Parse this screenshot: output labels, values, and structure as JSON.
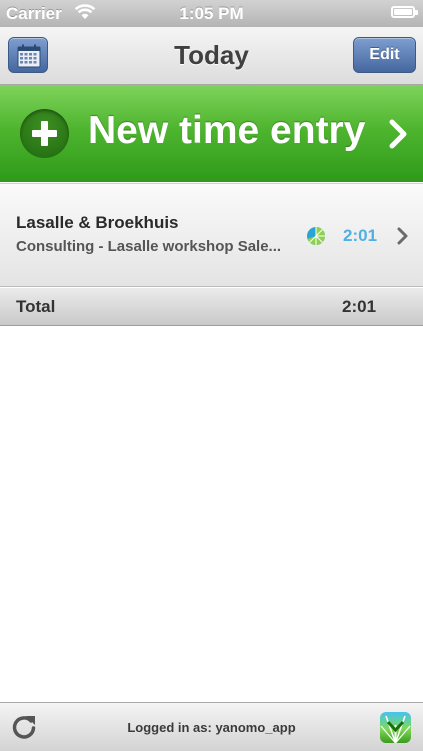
{
  "status_bar": {
    "carrier": "Carrier",
    "time": "1:05 PM",
    "wifi_icon": "wifi-icon",
    "battery_icon": "battery-icon"
  },
  "nav": {
    "title": "Today",
    "calendar_icon": "calendar-icon",
    "edit_label": "Edit"
  },
  "new_entry": {
    "label": "New time entry",
    "plus_icon": "plus-circle-icon",
    "chevron_icon": "chevron-right-icon"
  },
  "entries": [
    {
      "client": "Lasalle & Broekhuis",
      "description": "Consulting - Lasalle workshop Sale...",
      "duration": "2:01",
      "status_icon": "timer-running-icon"
    }
  ],
  "total": {
    "label": "Total",
    "value": "2:01"
  },
  "bottom_bar": {
    "login_text": "Logged in as: yanomo_app",
    "refresh_icon": "refresh-icon",
    "app_icon": "yanomo-app-icon"
  },
  "colors": {
    "accent_green": "#3aa623",
    "nav_button_blue": "#5577ad",
    "duration_blue": "#4fb0e2"
  }
}
